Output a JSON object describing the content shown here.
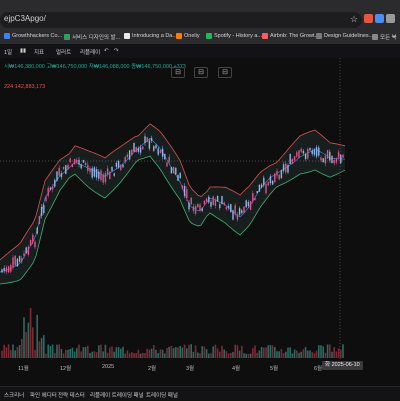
{
  "browser": {
    "url": "ejpC3Apgo/",
    "extensions": [
      "#e8563f",
      "#4b8cf5",
      "#9a9a9a",
      "#f2a23a",
      "#5aa0f0"
    ],
    "bookmarks": [
      {
        "label": "Growthhackers Co...",
        "color": "#3b82f6"
      },
      {
        "label": "서비스 디자인의 발...",
        "color": "#2f9e5f"
      },
      {
        "label": "Introducing a Da...",
        "color": "#e9e9e9"
      },
      {
        "label": "Oneliy",
        "color": "#ff7a00"
      },
      {
        "label": "Spotify - History a...",
        "color": "#1db954"
      },
      {
        "label": "Airbnb: The Growt...",
        "color": "#ff5a5f"
      },
      {
        "label": "Design Guidelines...",
        "color": "#7a7a7a"
      },
      {
        "label": "모든 북",
        "color": "#888888"
      }
    ]
  },
  "toolbar": {
    "interval": "1일",
    "indicators": "지표",
    "alert": "얼러트",
    "replay": "리플레이"
  },
  "legend": {
    "ohlc": "시₩146,380,000  고₩146,750,000  저₩146,088,000  종₩146,750,000  +373",
    "indicator_value": "224  142,883,173"
  },
  "x_axis": {
    "labels": [
      "11월",
      "12월",
      "2025",
      "2월",
      "3월",
      "4월",
      "5월",
      "6월"
    ],
    "current_date": "화 2025-06-10"
  },
  "bottom_bar": {
    "items": [
      "스크리너",
      "파인 에디터",
      "전략 테스터",
      "리플레이 트레이딩 패널",
      "트레이딩 패널"
    ]
  },
  "colors": {
    "up": "#26a69a",
    "down": "#ef5350",
    "band": "#2a3b38"
  }
}
